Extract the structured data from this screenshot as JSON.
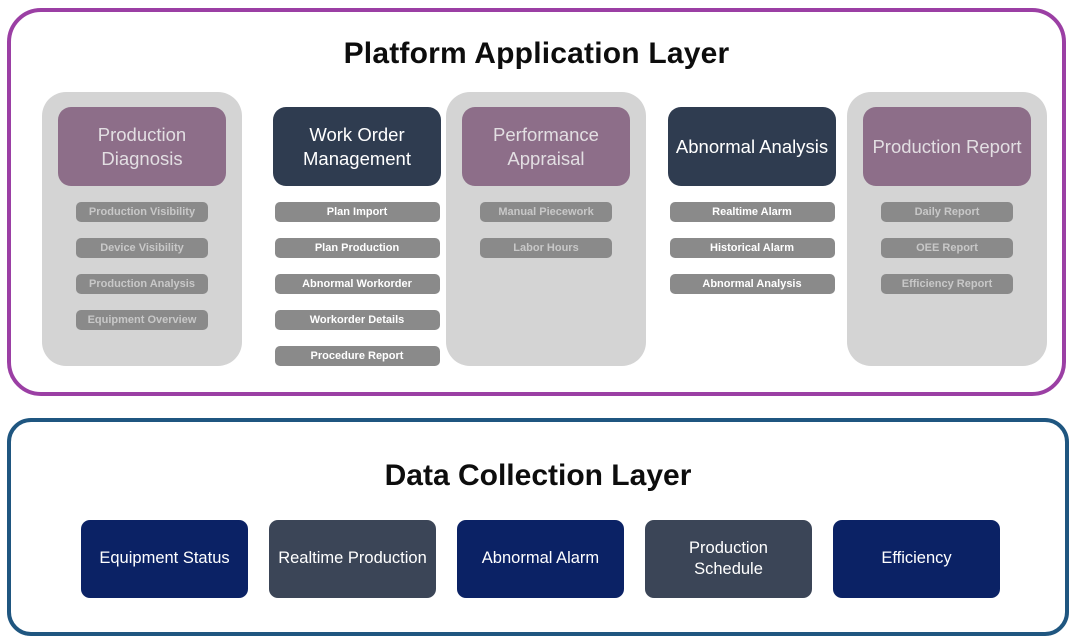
{
  "colors": {
    "platform_border": "#9b3fa4",
    "data_border": "#1f5680",
    "header_purple": "#8d6e89",
    "header_navy": "#2f3c50",
    "panel_gray": "#d4d4d4",
    "item_gray": "#8a8a8a",
    "box_navy": "#0b2265",
    "box_slate": "#3b4557"
  },
  "platform_layer": {
    "title": "Platform Application Layer",
    "columns": [
      {
        "header": "Production Diagnosis",
        "header_style": "purple",
        "panelled": true,
        "item_style": "dim",
        "items": [
          "Production Visibility",
          "Device Visibility",
          "Production Analysis",
          "Equipment Overview"
        ]
      },
      {
        "header": "Work Order Management",
        "header_style": "navy",
        "panelled": false,
        "item_style": "bright",
        "items": [
          "Plan Import",
          "Plan Production",
          "Abnormal Workorder",
          "Workorder Details",
          "Procedure Report"
        ]
      },
      {
        "header": "Performance Appraisal",
        "header_style": "purple",
        "panelled": true,
        "item_style": "dim",
        "items": [
          "Manual Piecework",
          "Labor Hours"
        ]
      },
      {
        "header": "Abnormal Analysis",
        "header_style": "navy",
        "panelled": false,
        "item_style": "bright",
        "items": [
          "Realtime Alarm",
          "Historical Alarm",
          "Abnormal Analysis"
        ]
      },
      {
        "header": "Production Report",
        "header_style": "purple",
        "panelled": true,
        "item_style": "dim",
        "items": [
          "Daily Report",
          "OEE Report",
          "Efficiency Report"
        ]
      }
    ]
  },
  "data_layer": {
    "title": "Data Collection Layer",
    "boxes": [
      {
        "label": "Equipment Status",
        "style": "navy"
      },
      {
        "label": "Realtime Production",
        "style": "slate"
      },
      {
        "label": "Abnormal Alarm",
        "style": "navy"
      },
      {
        "label": "Production Schedule",
        "style": "slate"
      },
      {
        "label": "Efficiency",
        "style": "navy"
      }
    ]
  }
}
